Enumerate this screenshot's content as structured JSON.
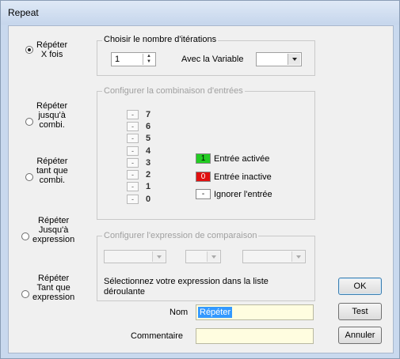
{
  "window": {
    "title": "Repeat"
  },
  "modes": [
    {
      "label": "Répéter\nX fois",
      "checked": true
    },
    {
      "label": "Répéter\njusqu'à\ncombi.",
      "checked": false
    },
    {
      "label": "Répéter\ntant que\ncombi.",
      "checked": false
    },
    {
      "label": "Répéter\nJusqu'à\nexpression",
      "checked": false
    },
    {
      "label": "Répéter\nTant que\nexpression",
      "checked": false
    }
  ],
  "iterations": {
    "legend": "Choisir le nombre d'itérations",
    "value": "1",
    "variable_label": "Avec la Variable",
    "variable_value": ""
  },
  "combination": {
    "legend": "Configurer la combinaison d'entrées",
    "inputs": [
      {
        "state": "-",
        "num": "7"
      },
      {
        "state": "-",
        "num": "6"
      },
      {
        "state": "-",
        "num": "5"
      },
      {
        "state": "-",
        "num": "4"
      },
      {
        "state": "-",
        "num": "3"
      },
      {
        "state": "-",
        "num": "2"
      },
      {
        "state": "-",
        "num": "1"
      },
      {
        "state": "-",
        "num": "0"
      }
    ],
    "legend_items": [
      {
        "symbol": "1",
        "label": "Entrée activée",
        "color": "#22cc22"
      },
      {
        "symbol": "0",
        "label": "Entrée inactive",
        "color": "#e01010"
      },
      {
        "symbol": "-",
        "label": "Ignorer l'entrée",
        "color": "#ffffff"
      }
    ]
  },
  "expression": {
    "legend": "Configurer l'expression de comparaison",
    "hint": "Sélectionnez votre expression dans la liste déroulante"
  },
  "fields": {
    "name_label": "Nom",
    "name_value": "Répéter",
    "comment_label": "Commentaire",
    "comment_value": ""
  },
  "buttons": {
    "ok": "OK",
    "test": "Test",
    "cancel": "Annuler"
  },
  "colors": {
    "field_bg": "#fffde0",
    "selection": "#3399ff"
  }
}
